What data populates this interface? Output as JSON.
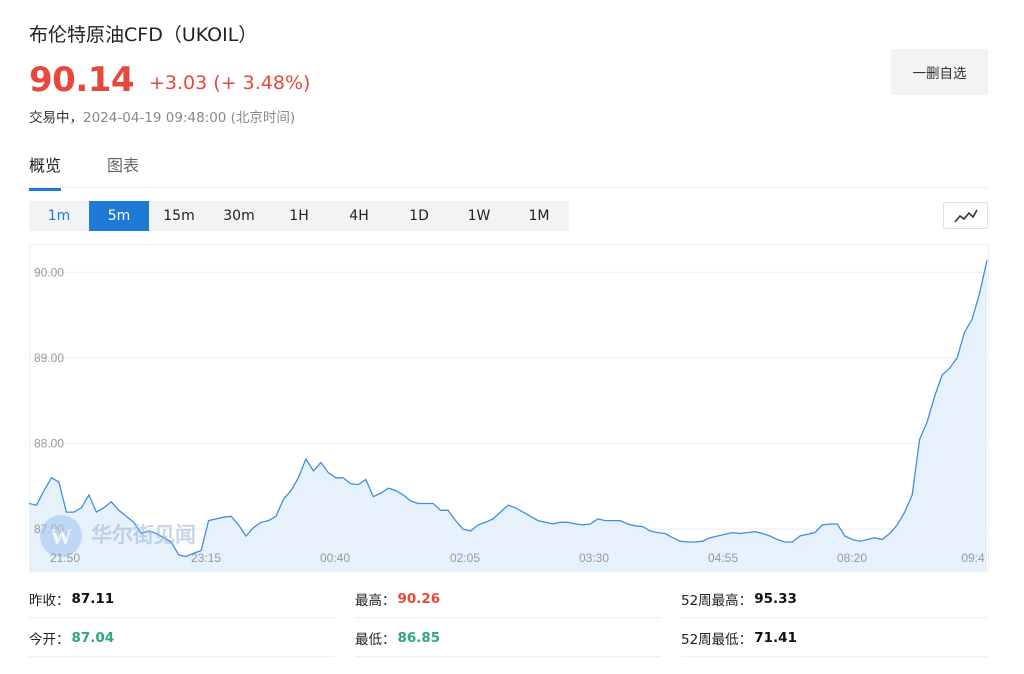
{
  "header": {
    "title": "布伦特原油CFD（UKOIL）",
    "price": "90.14",
    "change": "+3.03 (+ 3.48%)",
    "status_label": "交易中，",
    "timestamp": "2024-04-19 09:48:00 (北京时间)",
    "watch_button": "一删自选"
  },
  "tabs": [
    "概览",
    "图表"
  ],
  "periods": [
    "1m",
    "5m",
    "15m",
    "30m",
    "1H",
    "4H",
    "1D",
    "1W",
    "1M"
  ],
  "active_period": "5m",
  "watermark": "华尔街见闻",
  "colors": {
    "up": "#e8473b",
    "down": "#2ea87e",
    "accent": "#1f7ad6",
    "line": "#3f8fe0",
    "fill": "#e6f1fc"
  },
  "chart_data": {
    "type": "area",
    "yticks": [
      "90.00",
      "89.00",
      "88.00",
      "87.00"
    ],
    "ytick_values": [
      90,
      89,
      88,
      87
    ],
    "xticks": [
      "21:50",
      "23:15",
      "00:40",
      "02:05",
      "03:30",
      "04:55",
      "08:20",
      "09:4"
    ],
    "ylim": [
      86.5,
      90.33
    ],
    "values": [
      87.3,
      87.28,
      87.45,
      87.6,
      87.55,
      87.2,
      87.2,
      87.25,
      87.4,
      87.2,
      87.25,
      87.32,
      87.22,
      87.15,
      87.08,
      86.95,
      86.98,
      86.95,
      86.9,
      86.85,
      86.7,
      86.68,
      86.72,
      86.75,
      87.1,
      87.12,
      87.14,
      87.15,
      87.05,
      86.92,
      87.02,
      87.08,
      87.1,
      87.15,
      87.35,
      87.45,
      87.6,
      87.82,
      87.68,
      87.78,
      87.66,
      87.6,
      87.6,
      87.53,
      87.52,
      87.58,
      87.38,
      87.42,
      87.48,
      87.45,
      87.4,
      87.33,
      87.3,
      87.3,
      87.3,
      87.22,
      87.22,
      87.1,
      87.0,
      86.98,
      87.05,
      87.08,
      87.12,
      87.2,
      87.28,
      87.25,
      87.2,
      87.15,
      87.1,
      87.08,
      87.06,
      87.08,
      87.08,
      87.06,
      87.05,
      87.06,
      87.12,
      87.1,
      87.1,
      87.1,
      87.06,
      87.04,
      87.03,
      86.98,
      86.96,
      86.95,
      86.9,
      86.86,
      86.85,
      86.85,
      86.86,
      86.9,
      86.92,
      86.94,
      86.96,
      86.95,
      86.96,
      86.97,
      86.95,
      86.92,
      86.88,
      86.85,
      86.85,
      86.92,
      86.94,
      86.96,
      87.05,
      87.06,
      87.06,
      86.92,
      86.88,
      86.86,
      86.88,
      86.9,
      86.88,
      86.95,
      87.05,
      87.2,
      87.4,
      88.05,
      88.25,
      88.55,
      88.8,
      88.88,
      89.0,
      89.3,
      89.45,
      89.75,
      90.14
    ],
    "prev_close_label": "昨收：",
    "prev_close": "87.11",
    "open_label": "今开：",
    "open": "87.04",
    "high_label": "最高：",
    "high": "90.26",
    "low_label": "最低：",
    "low": "86.85",
    "high52_label": "52周最高：",
    "high52": "95.33",
    "low52_label": "52周最低：",
    "low52": "71.41"
  }
}
